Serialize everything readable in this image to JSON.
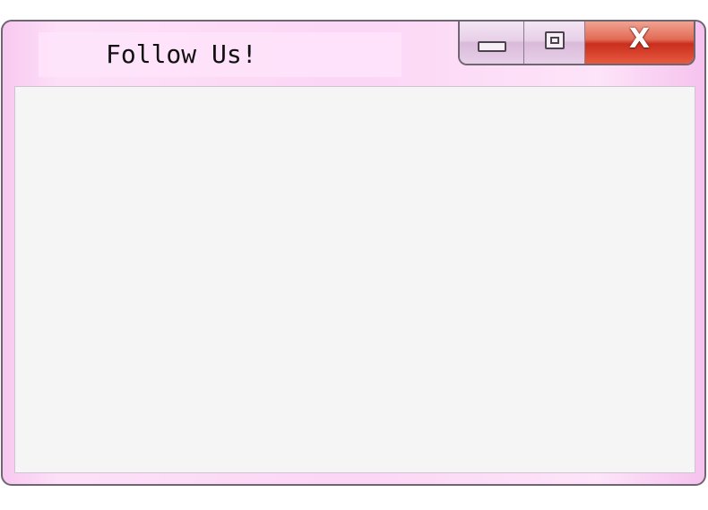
{
  "window": {
    "title": "Follow Us!",
    "controls": {
      "minimize_icon": "minimize-icon",
      "maximize_icon": "maximize-icon",
      "close_icon": "close-icon",
      "close_glyph": "X"
    }
  },
  "colors": {
    "frame": "#fcd6f5",
    "frame_border": "#6e6670",
    "content_bg": "#f5f5f5",
    "close_red": "#c92e1c",
    "title_text": "#111111"
  }
}
